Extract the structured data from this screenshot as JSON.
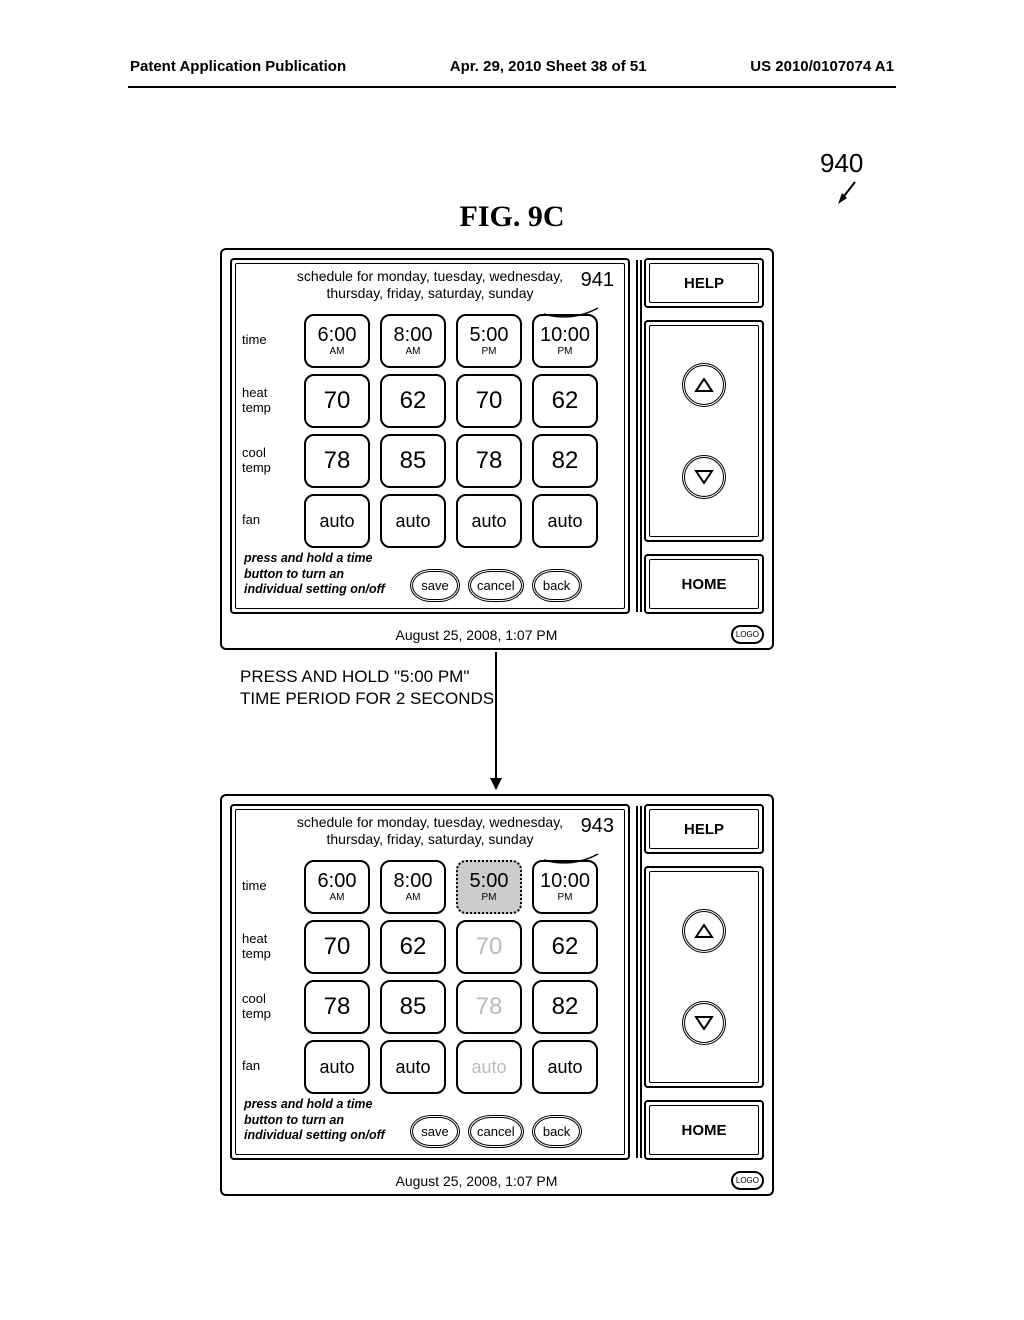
{
  "header": {
    "left": "Patent Application Publication",
    "center": "Apr. 29, 2010  Sheet 38 of 51",
    "right": "US 2010/0107074 A1"
  },
  "figure_label": "FIG. 9C",
  "ref_940": "940",
  "transition_text": "PRESS AND HOLD \"5:00 PM\" TIME PERIOD FOR 2 SECONDS",
  "screens": [
    {
      "callout": "941",
      "title_line1": "schedule for monday, tuesday, wednesday,",
      "title_line2": "thursday, friday, saturday, sunday",
      "rows": {
        "time_label": "time",
        "heat_label": "heat\ntemp",
        "cool_label": "cool\ntemp",
        "fan_label": "fan"
      },
      "cols": [
        {
          "time": "6:00",
          "ampm": "AM",
          "heat": "70",
          "cool": "78",
          "fan": "auto",
          "dim": false,
          "sel": false
        },
        {
          "time": "8:00",
          "ampm": "AM",
          "heat": "62",
          "cool": "85",
          "fan": "auto",
          "dim": false,
          "sel": false
        },
        {
          "time": "5:00",
          "ampm": "PM",
          "heat": "70",
          "cool": "78",
          "fan": "auto",
          "dim": false,
          "sel": false
        },
        {
          "time": "10:00",
          "ampm": "PM",
          "heat": "62",
          "cool": "82",
          "fan": "auto",
          "dim": false,
          "sel": false
        }
      ],
      "hint": "press and hold a time button to turn an individual setting on/off",
      "buttons": {
        "save": "save",
        "cancel": "cancel",
        "back": "back"
      },
      "side": {
        "help": "HELP",
        "home": "HOME"
      },
      "datetime": "August 25, 2008, 1:07 PM",
      "logo": "LOGO"
    },
    {
      "callout": "943",
      "title_line1": "schedule for monday, tuesday, wednesday,",
      "title_line2": "thursday, friday, saturday, sunday",
      "rows": {
        "time_label": "time",
        "heat_label": "heat\ntemp",
        "cool_label": "cool\ntemp",
        "fan_label": "fan"
      },
      "cols": [
        {
          "time": "6:00",
          "ampm": "AM",
          "heat": "70",
          "cool": "78",
          "fan": "auto",
          "dim": false,
          "sel": false
        },
        {
          "time": "8:00",
          "ampm": "AM",
          "heat": "62",
          "cool": "85",
          "fan": "auto",
          "dim": false,
          "sel": false
        },
        {
          "time": "5:00",
          "ampm": "PM",
          "heat": "70",
          "cool": "78",
          "fan": "auto",
          "dim": true,
          "sel": true
        },
        {
          "time": "10:00",
          "ampm": "PM",
          "heat": "62",
          "cool": "82",
          "fan": "auto",
          "dim": false,
          "sel": false
        }
      ],
      "hint": "press and hold a time button to turn an individual setting on/off",
      "buttons": {
        "save": "save",
        "cancel": "cancel",
        "back": "back"
      },
      "side": {
        "help": "HELP",
        "home": "HOME"
      },
      "datetime": "August 25, 2008, 1:07 PM",
      "logo": "LOGO"
    }
  ]
}
